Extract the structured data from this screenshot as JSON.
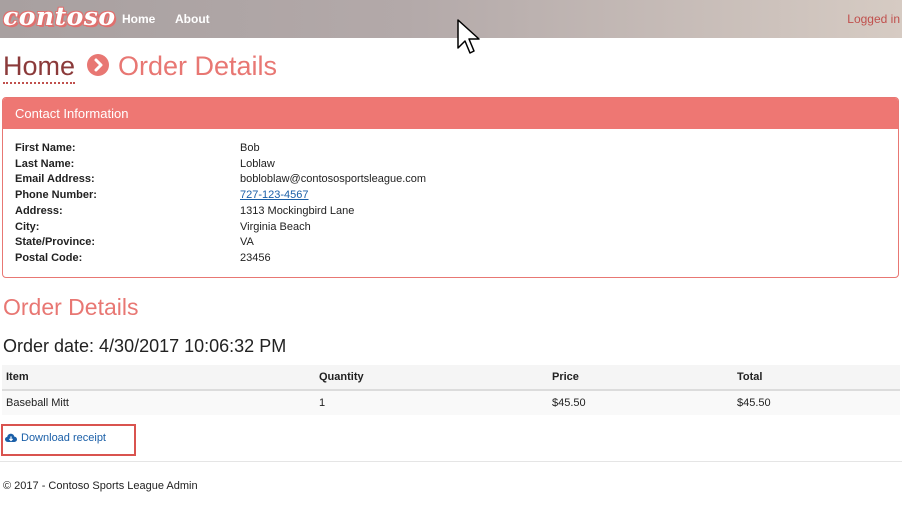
{
  "navbar": {
    "brand": "contoso",
    "links": [
      {
        "label": "Home"
      },
      {
        "label": "About"
      }
    ],
    "user_status": "Logged in"
  },
  "breadcrumb": {
    "home": "Home",
    "current": "Order Details",
    "separator_icon": "chevron-right-circle-icon"
  },
  "contact": {
    "heading": "Contact Information",
    "fields": [
      {
        "label": "First Name:",
        "value": "Bob"
      },
      {
        "label": "Last Name:",
        "value": "Loblaw"
      },
      {
        "label": "Email Address:",
        "value": "bobloblaw@contososportsleague.com"
      },
      {
        "label": "Phone Number:",
        "value": "727-123-4567"
      },
      {
        "label": "Address:",
        "value": "1313 Mockingbird Lane"
      },
      {
        "label": "City:",
        "value": "Virginia Beach"
      },
      {
        "label": "State/Province:",
        "value": "VA"
      },
      {
        "label": "Postal Code:",
        "value": "23456"
      }
    ]
  },
  "order": {
    "title": "Order Details",
    "date": "Order date: 4/30/2017 10:06:32 PM",
    "columns": [
      "Item",
      "Quantity",
      "Price",
      "Total"
    ],
    "rows": [
      [
        "Baseball Mitt",
        "1",
        "$45.50",
        "$45.50"
      ]
    ]
  },
  "download": {
    "label": "Download receipt",
    "icon": "cloud-download-icon"
  },
  "footer": {
    "text": "© 2017 - Contoso Sports League Admin"
  },
  "colors": {
    "accent": "#ee7773",
    "link": "#1a5fa8",
    "highlight_box": "#d9534f"
  }
}
